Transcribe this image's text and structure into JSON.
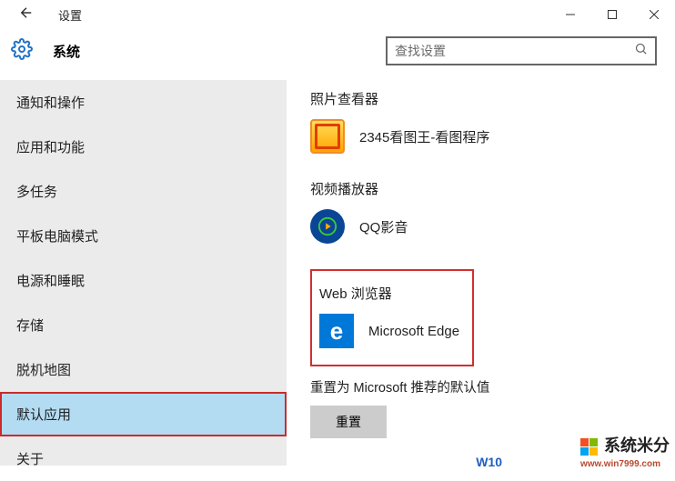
{
  "window": {
    "title": "设置"
  },
  "header": {
    "title": "系统",
    "search_placeholder": "查找设置"
  },
  "sidebar": {
    "items": [
      {
        "label": "通知和操作"
      },
      {
        "label": "应用和功能"
      },
      {
        "label": "多任务"
      },
      {
        "label": "平板电脑模式"
      },
      {
        "label": "电源和睡眠"
      },
      {
        "label": "存储"
      },
      {
        "label": "脱机地图"
      },
      {
        "label": "默认应用",
        "selected": true
      },
      {
        "label": "关于"
      }
    ]
  },
  "main": {
    "photo_viewer": {
      "title": "照片查看器",
      "app": "2345看图王-看图程序"
    },
    "video_player": {
      "title": "视频播放器",
      "app": "QQ影音"
    },
    "web_browser": {
      "title": "Web 浏览器",
      "app": "Microsoft Edge"
    },
    "reset": {
      "text": "重置为 Microsoft 推荐的默认值",
      "button": "重置"
    }
  },
  "watermark": {
    "text": "系统米分",
    "url": "www.win7999.com",
    "w": "W10"
  }
}
